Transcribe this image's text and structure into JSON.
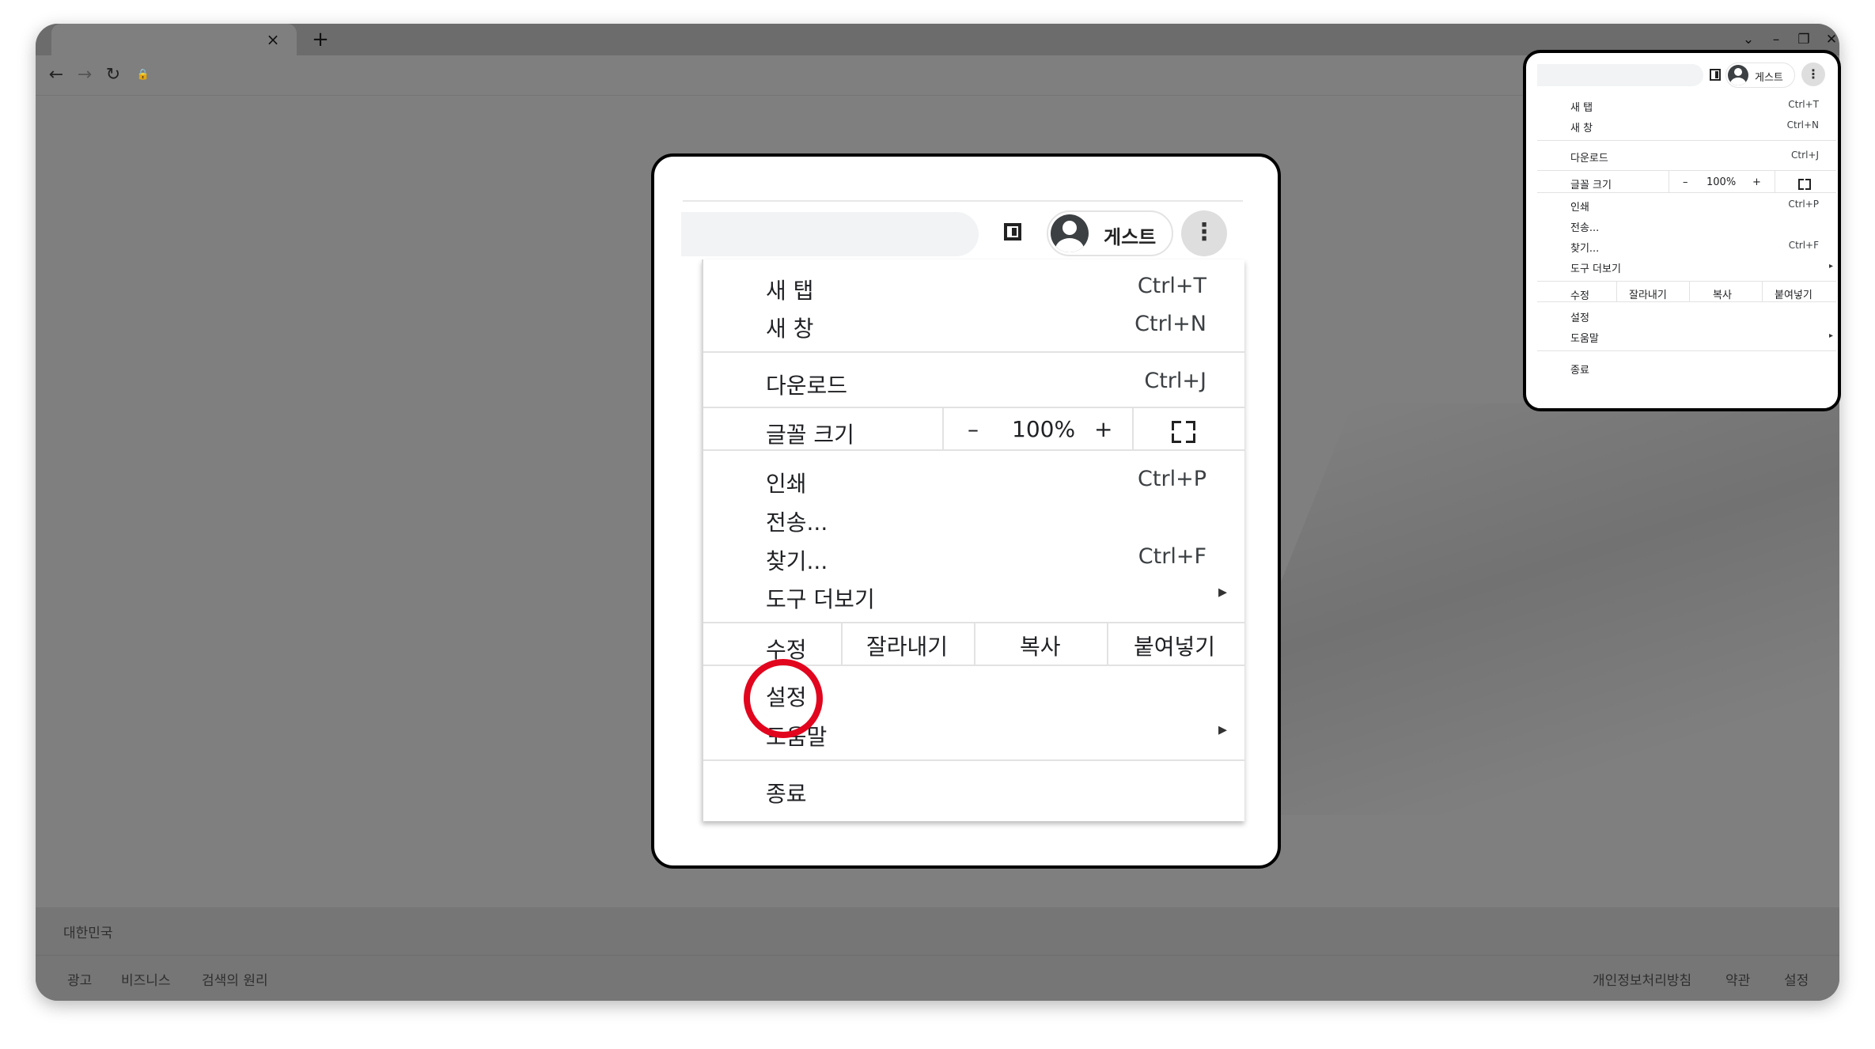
{
  "window": {
    "tab_close": "×",
    "new_tab": "+",
    "controls": {
      "tab_search": "⌄",
      "minimize": "–",
      "restore": "❐",
      "close": "✕"
    },
    "nav": {
      "back": "←",
      "forward": "→",
      "reload": "↻",
      "lock": "🔒"
    }
  },
  "profile": {
    "label": "게스트",
    "more_icon": "⋮"
  },
  "menu": {
    "new_tab": {
      "label": "새 탭",
      "shortcut": "Ctrl+T"
    },
    "new_window": {
      "label": "새 창",
      "shortcut": "Ctrl+N"
    },
    "downloads": {
      "label": "다운로드",
      "shortcut": "Ctrl+J"
    },
    "zoom": {
      "label": "글꼴 크기",
      "minus": "–",
      "value": "100%",
      "plus": "+"
    },
    "print": {
      "label": "인쇄",
      "shortcut": "Ctrl+P"
    },
    "cast": {
      "label": "전송..."
    },
    "find": {
      "label": "찾기...",
      "shortcut": "Ctrl+F"
    },
    "more_tools": {
      "label": "도구 더보기",
      "arrow": "▸"
    },
    "edit": {
      "label": "수정",
      "cut": "잘라내기",
      "copy": "복사",
      "paste": "붙여넣기"
    },
    "settings": {
      "label": "설정"
    },
    "help": {
      "label": "도움말",
      "arrow": "▸"
    },
    "exit": {
      "label": "종료"
    }
  },
  "footer": {
    "country": "대한민국",
    "left_links": [
      "광고",
      "비즈니스",
      "검색의 원리"
    ],
    "right_links": [
      "개인정보처리방침",
      "약관",
      "설정"
    ]
  },
  "colors": {
    "highlight": "#e2051e",
    "page_dim": "#7f7f7f"
  }
}
